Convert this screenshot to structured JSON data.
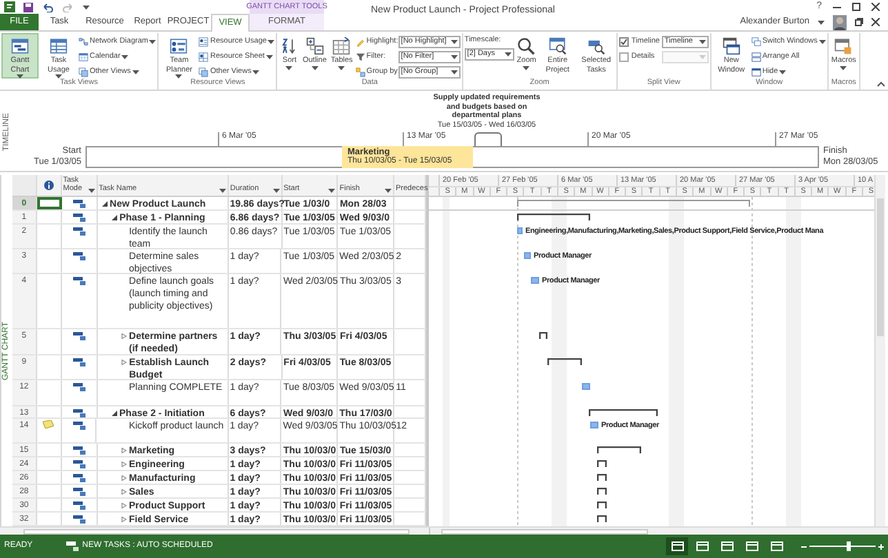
{
  "title_bar": {
    "context_tab": "GANTT CHART TOOLS",
    "title": "New Product Launch - Project Professional",
    "help": "?"
  },
  "tabs": [
    {
      "label": "FILE",
      "kind": "file",
      "selected": false
    },
    {
      "label": "Task",
      "kind": "tab",
      "selected": false
    },
    {
      "label": "Resource",
      "kind": "tab",
      "selected": false
    },
    {
      "label": "Report",
      "kind": "tab",
      "selected": false
    },
    {
      "label": "PROJECT",
      "kind": "tab",
      "selected": false
    },
    {
      "label": "VIEW",
      "kind": "tab",
      "selected": true
    },
    {
      "label": "FORMAT",
      "kind": "context",
      "selected": false
    }
  ],
  "user": {
    "name": "Alexander Burton"
  },
  "ribbon": {
    "groups": [
      {
        "label": "Task Views",
        "items": [
          {
            "kind": "large",
            "label": "Gantt Chart",
            "dropdown": true,
            "selected": true
          },
          {
            "kind": "large",
            "label": "Task Usage",
            "dropdown": true,
            "selected": false
          },
          {
            "kind": "small",
            "label": "Network Diagram",
            "dropdown": true
          },
          {
            "kind": "small",
            "label": "Calendar",
            "dropdown": true
          },
          {
            "kind": "small",
            "label": "Other Views",
            "dropdown": true
          }
        ]
      },
      {
        "label": "Resource Views",
        "items": [
          {
            "kind": "large",
            "label": "Team Planner",
            "dropdown": true,
            "selected": false
          },
          {
            "kind": "small",
            "label": "Resource Usage",
            "dropdown": true
          },
          {
            "kind": "small",
            "label": "Resource Sheet",
            "dropdown": true
          },
          {
            "kind": "small",
            "label": "Other Views",
            "dropdown": true
          }
        ]
      },
      {
        "label": "Data",
        "items": [
          {
            "kind": "large",
            "label": "Sort",
            "dropdown": true
          },
          {
            "kind": "large",
            "label": "Outline",
            "dropdown": true
          },
          {
            "kind": "large",
            "label": "Tables",
            "dropdown": true
          },
          {
            "kind": "field",
            "label": "Highlight:",
            "value": "[No Highlight]"
          },
          {
            "kind": "field",
            "label": "Filter:",
            "value": "[No Filter]"
          },
          {
            "kind": "field",
            "label": "Group by:",
            "value": "[No Group]"
          }
        ]
      },
      {
        "label": "Zoom",
        "items": [
          {
            "kind": "timescale",
            "label": "Timescale:",
            "value": "[2] Days"
          },
          {
            "kind": "large",
            "label": "Zoom",
            "dropdown": true
          },
          {
            "kind": "large",
            "label": "Entire Project",
            "dropdown": false
          },
          {
            "kind": "large",
            "label": "Selected Tasks",
            "dropdown": false
          }
        ]
      },
      {
        "label": "Split View",
        "items": [
          {
            "kind": "check",
            "label": "Timeline",
            "checked": true,
            "value": "Timeline"
          },
          {
            "kind": "check",
            "label": "Details",
            "checked": false
          }
        ]
      },
      {
        "label": "Window",
        "items": [
          {
            "kind": "large",
            "label": "New Window",
            "dropdown": false
          },
          {
            "kind": "small",
            "label": "Switch Windows",
            "dropdown": true
          },
          {
            "kind": "small",
            "label": "Arrange All",
            "dropdown": false
          },
          {
            "kind": "small",
            "label": "Hide",
            "dropdown": true
          }
        ]
      },
      {
        "label": "Macros",
        "items": [
          {
            "kind": "large",
            "label": "Macros",
            "dropdown": true
          }
        ]
      }
    ]
  },
  "timeline": {
    "label": "TIMELINE",
    "start_label": "Start",
    "start": "Tue 1/03/05",
    "finish_label": "Finish",
    "finish": "Mon 28/03/05",
    "ticks": [
      "6 Mar '05",
      "13 Mar '05",
      "20 Mar '05",
      "27 Mar '05"
    ],
    "bar": {
      "name": "Marketing",
      "dates": "Thu 10/03/05 - Tue 15/03/05"
    },
    "callout": {
      "name": "Supply updated requirements and budgets based on departmental plans",
      "dates": "Tue 15/03/05 - Wed 16/03/05"
    }
  },
  "side_label": "GANTT CHART",
  "table": {
    "columns": [
      {
        "label": "Task Mode",
        "dropdown": true
      },
      {
        "label": "Task Name",
        "dropdown": true
      },
      {
        "label": "Duration",
        "dropdown": true
      },
      {
        "label": "Start",
        "dropdown": true
      },
      {
        "label": "Finish",
        "dropdown": true
      },
      {
        "label": "Predeces",
        "dropdown": false
      }
    ]
  },
  "gantt": {
    "weeks": [
      "20 Feb '05",
      "27 Feb '05",
      "6 Mar '05",
      "13 Mar '05",
      "20 Mar '05",
      "27 Mar '05",
      "3 Apr '05",
      "10 A"
    ],
    "days": [
      "S",
      "M",
      "W",
      "F",
      "S",
      "T",
      "T",
      "S",
      "M",
      "W",
      "F",
      "S",
      "T",
      "T",
      "S",
      "M",
      "W",
      "F",
      "S",
      "T",
      "T",
      "S",
      "M",
      "W",
      "F",
      "S"
    ]
  },
  "tasks": [
    {
      "id": "0",
      "kind": "summary",
      "name": "New Product Launch",
      "duration": "19.86 days?",
      "start": "Tue 1/03/0",
      "finish": "Mon 28/03",
      "expanded": true,
      "selected": true,
      "note": false,
      "children": [
        {
          "id": "1",
          "kind": "summary",
          "name": "Phase 1 - Planning",
          "duration": "6.86 days?",
          "start": "Tue 1/03/05",
          "finish": "Wed 9/03/0",
          "expanded": true,
          "selected": false,
          "note": false,
          "children": [
            {
              "id": "2",
              "kind": "task",
              "name": "Identify the launch team",
              "duration": "0.86 days?",
              "start": "Tue 1/03/05",
              "finish": "Tue 1/03/05",
              "resources": "Engineering,Manufacturing,Marketing,Sales,Product Support,Field Service,Product Mana",
              "selected": false,
              "note": false
            },
            {
              "id": "3",
              "kind": "task",
              "name": "Determine sales objectives",
              "duration": "1 day?",
              "start": "Tue 1/03/05",
              "finish": "Wed 2/03/05",
              "predecessors": "2",
              "resources": "Product Manager",
              "selected": false,
              "note": false
            },
            {
              "id": "4",
              "kind": "task",
              "name": "Define launch goals (launch timing and publicity objectives)",
              "duration": "1 day?",
              "start": "Wed 2/03/05",
              "finish": "Thu 3/03/05",
              "predecessors": "3",
              "resources": "Product Manager",
              "selected": false,
              "note": false
            },
            {
              "id": "5",
              "kind": "summary",
              "name": "Determine partners (if needed)",
              "duration": "1 day?",
              "start": "Thu 3/03/05",
              "finish": "Fri 4/03/05",
              "expanded": false,
              "selected": false,
              "note": false
            },
            {
              "id": "9",
              "kind": "summary",
              "name": "Establish Launch Budget",
              "duration": "2 days?",
              "start": "Fri 4/03/05",
              "finish": "Tue 8/03/05",
              "expanded": false,
              "selected": false,
              "note": false
            },
            {
              "id": "12",
              "kind": "task",
              "name": "Planning COMPLETE",
              "duration": "1 day?",
              "start": "Tue 8/03/05",
              "finish": "Wed 9/03/05",
              "predecessors": "11",
              "selected": false,
              "note": false
            }
          ]
        },
        {
          "id": "13",
          "kind": "summary",
          "name": "Phase 2 - Initiation",
          "duration": "6 days?",
          "start": "Wed 9/03/0",
          "finish": "Thu 17/03/0",
          "expanded": true,
          "selected": false,
          "note": false,
          "children": [
            {
              "id": "14",
              "kind": "task",
              "name": "Kickoff product launch",
              "duration": "1 day?",
              "start": "Wed 9/03/05",
              "finish": "Thu 10/03/05",
              "predecessors": "12",
              "resources": "Product Manager",
              "selected": false,
              "note": true
            },
            {
              "id": "15",
              "kind": "summary",
              "name": "Marketing",
              "duration": "3 days?",
              "start": "Thu 10/03/0",
              "finish": "Tue 15/03/0",
              "expanded": false,
              "selected": false,
              "note": false
            },
            {
              "id": "24",
              "kind": "summary",
              "name": "Engineering",
              "duration": "1 day?",
              "start": "Thu 10/03/0",
              "finish": "Fri 11/03/05",
              "expanded": false,
              "selected": false,
              "note": false
            },
            {
              "id": "26",
              "kind": "summary",
              "name": "Manufacturing",
              "duration": "1 day?",
              "start": "Thu 10/03/0",
              "finish": "Fri 11/03/05",
              "expanded": false,
              "selected": false,
              "note": false
            },
            {
              "id": "28",
              "kind": "summary",
              "name": "Sales",
              "duration": "1 day?",
              "start": "Thu 10/03/0",
              "finish": "Fri 11/03/05",
              "expanded": false,
              "selected": false,
              "note": false
            },
            {
              "id": "30",
              "kind": "summary",
              "name": "Product Support",
              "duration": "1 day?",
              "start": "Thu 10/03/0",
              "finish": "Fri 11/03/05",
              "expanded": false,
              "selected": false,
              "note": false
            },
            {
              "id": "32",
              "kind": "summary",
              "name": "Field Service",
              "duration": "1 day?",
              "start": "Thu 10/03/0",
              "finish": "Fri 11/03/05",
              "expanded": false,
              "selected": false,
              "note": false
            }
          ]
        }
      ]
    }
  ],
  "status_bar": {
    "status": "READY",
    "mode": "NEW TASKS : AUTO SCHEDULED",
    "view_shortcuts": [
      {
        "selected": true
      },
      {
        "selected": false
      },
      {
        "selected": false
      },
      {
        "selected": false
      },
      {
        "selected": false
      }
    ],
    "zoom": {
      "level": 0.6
    }
  }
}
